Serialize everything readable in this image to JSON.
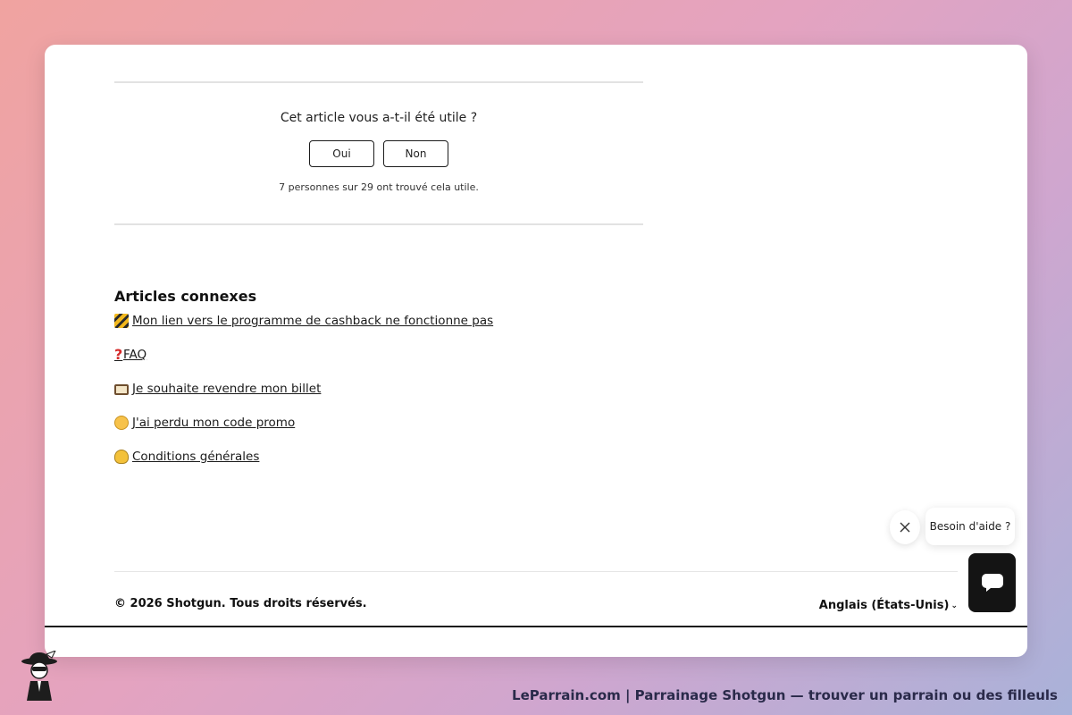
{
  "feedback": {
    "question": "Cet article vous a-t-il été utile ?",
    "yes_label": "Oui",
    "no_label": "Non",
    "stats": "7 personnes sur 29 ont trouvé cela utile."
  },
  "related": {
    "title": "Articles connexes",
    "items": [
      {
        "icon": "construction-barrier-icon",
        "label": "Mon lien vers le programme de cashback ne fonctionne pas"
      },
      {
        "icon": "red-question-mark-icon",
        "label": "FAQ"
      },
      {
        "icon": "ticket-icon",
        "label": "Je souhaite revendre mon billet"
      },
      {
        "icon": "thinking-face-icon",
        "label": "J'ai perdu mon code promo"
      },
      {
        "icon": "yellow-heart-icon",
        "label": "Conditions générales"
      }
    ]
  },
  "footer": {
    "copyright": "© 2026 Shotgun. Tous droits réservés.",
    "language": "Anglais (États-Unis)"
  },
  "help_widget": {
    "bubble_text": "Besoin d'aide ?",
    "close_icon": "close-icon",
    "launcher_icon": "chat-icon"
  },
  "caption": "LeParrain.com | Parrainage Shotgun — trouver un parrain ou des filleuls",
  "colors": {
    "accent_dark": "#141414",
    "card_bg": "#ffffff"
  }
}
